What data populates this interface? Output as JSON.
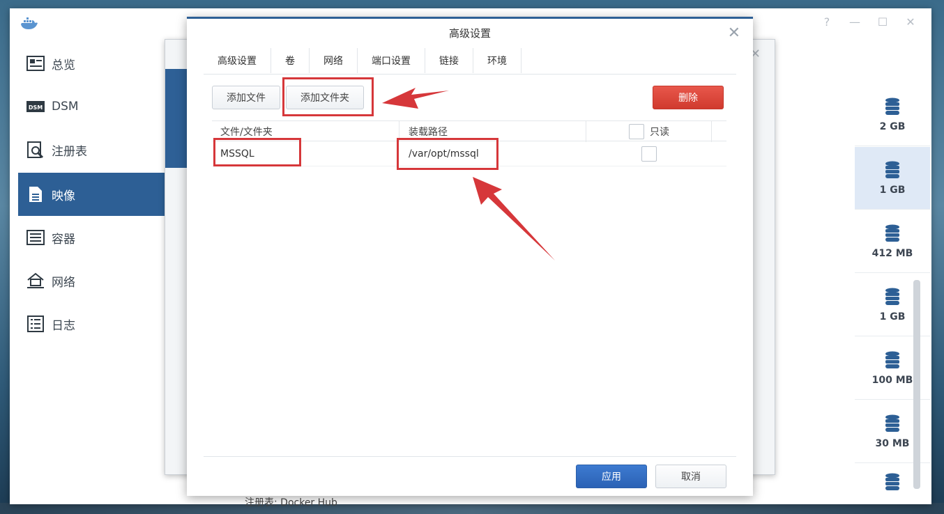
{
  "app": {
    "logo": "docker-whale-icon",
    "window_controls": [
      "help-icon",
      "minimize-icon",
      "maximize-icon",
      "close-icon"
    ]
  },
  "sidebar": {
    "items": [
      {
        "label": "总览",
        "icon": "overview-icon",
        "active": false
      },
      {
        "label": "DSM",
        "icon": "dsm-icon",
        "active": false
      },
      {
        "label": "注册表",
        "icon": "registry-icon",
        "active": false
      },
      {
        "label": "映像",
        "icon": "image-icon",
        "active": true
      },
      {
        "label": "容器",
        "icon": "container-icon",
        "active": false
      },
      {
        "label": "网络",
        "icon": "network-icon",
        "active": false
      },
      {
        "label": "日志",
        "icon": "log-icon",
        "active": false
      }
    ]
  },
  "sizes": [
    "2 GB",
    "1 GB",
    "412 MB",
    "1 GB",
    "100 MB",
    "30 MB"
  ],
  "background": {
    "registry_text": "注册表: Docker Hub"
  },
  "dialog": {
    "title": "高级设置",
    "tabs": [
      "高级设置",
      "卷",
      "网络",
      "端口设置",
      "链接",
      "环境"
    ],
    "active_tab": "卷",
    "buttons": {
      "add_file": "添加文件",
      "add_folder": "添加文件夹",
      "delete": "删除",
      "apply": "应用",
      "cancel": "取消"
    },
    "columns": {
      "file_folder": "文件/文件夹",
      "mount_path": "装载路径",
      "readonly": "只读"
    },
    "rows": [
      {
        "file_folder": "MSSQL",
        "mount_path": "/var/opt/mssql",
        "readonly": false
      }
    ]
  },
  "colors": {
    "accent": "#2d5f95",
    "danger": "#d03a2e",
    "annotation": "#d6373a"
  }
}
